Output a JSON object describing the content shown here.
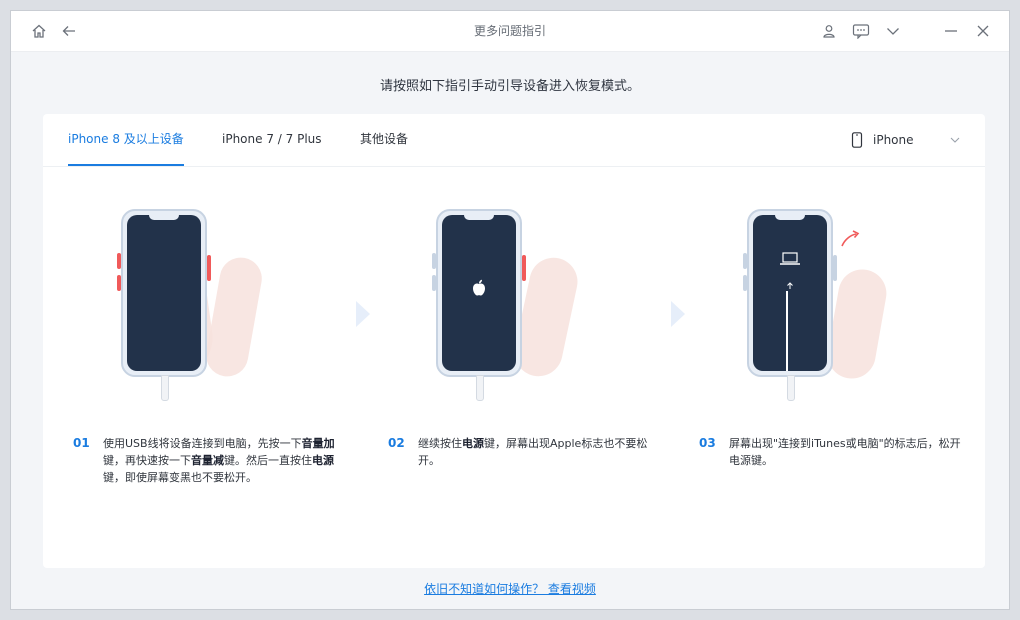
{
  "window": {
    "title": "更多问题指引"
  },
  "instruction": "请按照如下指引手动引导设备进入恢复模式。",
  "tabs": [
    {
      "label": "iPhone 8 及以上设备",
      "active": true
    },
    {
      "label": "iPhone 7 / 7 Plus",
      "active": false
    },
    {
      "label": "其他设备",
      "active": false
    }
  ],
  "device_selector": {
    "selected": "iPhone"
  },
  "steps": [
    {
      "num": "01",
      "text_a": "使用USB线将设备连接到电脑，先按一下",
      "bold_a": "音量加",
      "text_b": "键，再快速按一下",
      "bold_b": "音量减",
      "text_c": "键。然后一直按住",
      "bold_c": "电源",
      "text_d": "键，即使屏幕变黑也不要松开。"
    },
    {
      "num": "02",
      "text_a": "继续按住",
      "bold_a": "电源",
      "text_b": "键，屏幕出现Apple标志也不要松开。"
    },
    {
      "num": "03",
      "text_a": "屏幕出现\"连接到iTunes或电脑\"的标志后，松开电源键。"
    }
  ],
  "help_link": "依旧不知道如何操作？ 查看视频",
  "colors": {
    "accent": "#1a7ce0",
    "screen": "#22324a",
    "button_red": "#f05a5a"
  }
}
